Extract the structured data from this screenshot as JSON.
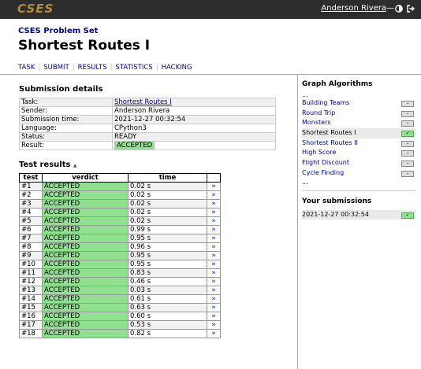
{
  "brand": "CSES",
  "user": {
    "name": "Anderson Rivera",
    "separator": "—"
  },
  "page": {
    "crumb": "CSES Problem Set",
    "title": "Shortest Routes I"
  },
  "nav": [
    "TASK",
    "SUBMIT",
    "RESULTS",
    "STATISTICS",
    "HACKING"
  ],
  "details": {
    "heading": "Submission details",
    "rows": [
      {
        "k": "Task:",
        "v": "Shortest Routes I"
      },
      {
        "k": "Sender:",
        "v": "Anderson Rivera"
      },
      {
        "k": "Submission time:",
        "v": "2021-12-27 00:32:54"
      },
      {
        "k": "Language:",
        "v": "CPython3"
      },
      {
        "k": "Status:",
        "v": "READY"
      },
      {
        "k": "Result:",
        "v": "ACCEPTED"
      }
    ]
  },
  "results": {
    "heading": "Test results",
    "arrow": "▲",
    "headers": [
      "test",
      "verdict",
      "time"
    ],
    "link_glyph": "»",
    "rows": [
      {
        "test": "#1",
        "verdict": "ACCEPTED",
        "time": "0.02 s"
      },
      {
        "test": "#2",
        "verdict": "ACCEPTED",
        "time": "0.02 s"
      },
      {
        "test": "#3",
        "verdict": "ACCEPTED",
        "time": "0.02 s"
      },
      {
        "test": "#4",
        "verdict": "ACCEPTED",
        "time": "0.02 s"
      },
      {
        "test": "#5",
        "verdict": "ACCEPTED",
        "time": "0.02 s"
      },
      {
        "test": "#6",
        "verdict": "ACCEPTED",
        "time": "0.99 s"
      },
      {
        "test": "#7",
        "verdict": "ACCEPTED",
        "time": "0.95 s"
      },
      {
        "test": "#8",
        "verdict": "ACCEPTED",
        "time": "0.96 s"
      },
      {
        "test": "#9",
        "verdict": "ACCEPTED",
        "time": "0.95 s"
      },
      {
        "test": "#10",
        "verdict": "ACCEPTED",
        "time": "0.95 s"
      },
      {
        "test": "#11",
        "verdict": "ACCEPTED",
        "time": "0.83 s"
      },
      {
        "test": "#12",
        "verdict": "ACCEPTED",
        "time": "0.46 s"
      },
      {
        "test": "#13",
        "verdict": "ACCEPTED",
        "time": "0.03 s"
      },
      {
        "test": "#14",
        "verdict": "ACCEPTED",
        "time": "0.61 s"
      },
      {
        "test": "#15",
        "verdict": "ACCEPTED",
        "time": "0.63 s"
      },
      {
        "test": "#16",
        "verdict": "ACCEPTED",
        "time": "0.60 s"
      },
      {
        "test": "#17",
        "verdict": "ACCEPTED",
        "time": "0.53 s"
      },
      {
        "test": "#18",
        "verdict": "ACCEPTED",
        "time": "0.82 s"
      }
    ]
  },
  "sidebar": {
    "heading": "Graph Algorithms",
    "ellipsis": "...",
    "items": [
      {
        "label": "Building Teams",
        "status": "–",
        "current": false,
        "solved": false
      },
      {
        "label": "Round Trip",
        "status": "–",
        "current": false,
        "solved": false
      },
      {
        "label": "Monsters",
        "status": "–",
        "current": false,
        "solved": false
      },
      {
        "label": "Shortest Routes I",
        "status": "✓",
        "current": true,
        "solved": true
      },
      {
        "label": "Shortest Routes II",
        "status": "–",
        "current": false,
        "solved": false
      },
      {
        "label": "High Score",
        "status": "–",
        "current": false,
        "solved": false
      },
      {
        "label": "Flight Discount",
        "status": "–",
        "current": false,
        "solved": false
      },
      {
        "label": "Cycle Finding",
        "status": "–",
        "current": false,
        "solved": false
      }
    ],
    "subs_heading": "Your submissions",
    "submissions": [
      {
        "time": "2021-12-27 00:32:54",
        "status": "✓"
      }
    ]
  },
  "colors": {
    "accepted": "#8fe08f",
    "topbar": "#2d2d2d",
    "link": "#00009a",
    "brand": "#b58b3a"
  }
}
